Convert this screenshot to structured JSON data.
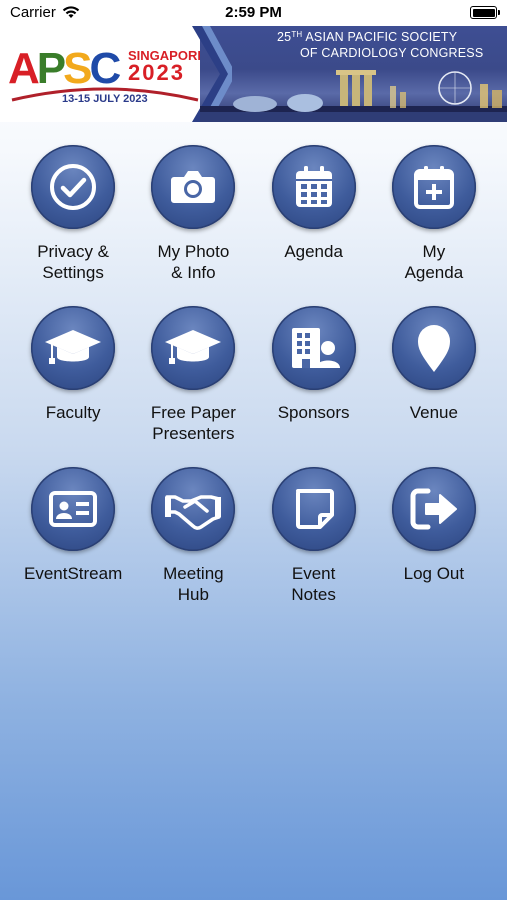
{
  "status_bar": {
    "carrier": "Carrier",
    "time": "2:59 PM"
  },
  "banner": {
    "logo": {
      "letters": [
        "A",
        "P",
        "S",
        "C"
      ],
      "city": "SINGAPORE",
      "year": "2023",
      "dates": "13-15 JULY 2023"
    },
    "congress_line1_num": "25",
    "congress_line1_sup": "TH",
    "congress_line1_rest": " ASIAN PACIFIC SOCIETY",
    "congress_line2": "OF CARDIOLOGY CONGRESS"
  },
  "menu": [
    {
      "label": "Privacy &\nSettings",
      "icon": "check-circle-icon"
    },
    {
      "label": "My Photo\n& Info",
      "icon": "camera-icon"
    },
    {
      "label": "Agenda",
      "icon": "calendar-icon"
    },
    {
      "label": "My\nAgenda",
      "icon": "calendar-plus-icon"
    },
    {
      "label": "Faculty",
      "icon": "graduation-cap-icon"
    },
    {
      "label": "Free Paper\nPresenters",
      "icon": "graduation-cap-icon"
    },
    {
      "label": "Sponsors",
      "icon": "building-user-icon"
    },
    {
      "label": "Venue",
      "icon": "map-pin-icon"
    },
    {
      "label": "EventStream",
      "icon": "id-card-icon"
    },
    {
      "label": "Meeting\nHub",
      "icon": "handshake-icon"
    },
    {
      "label": "Event\nNotes",
      "icon": "sticky-note-icon"
    },
    {
      "label": "Log Out",
      "icon": "logout-icon"
    }
  ]
}
